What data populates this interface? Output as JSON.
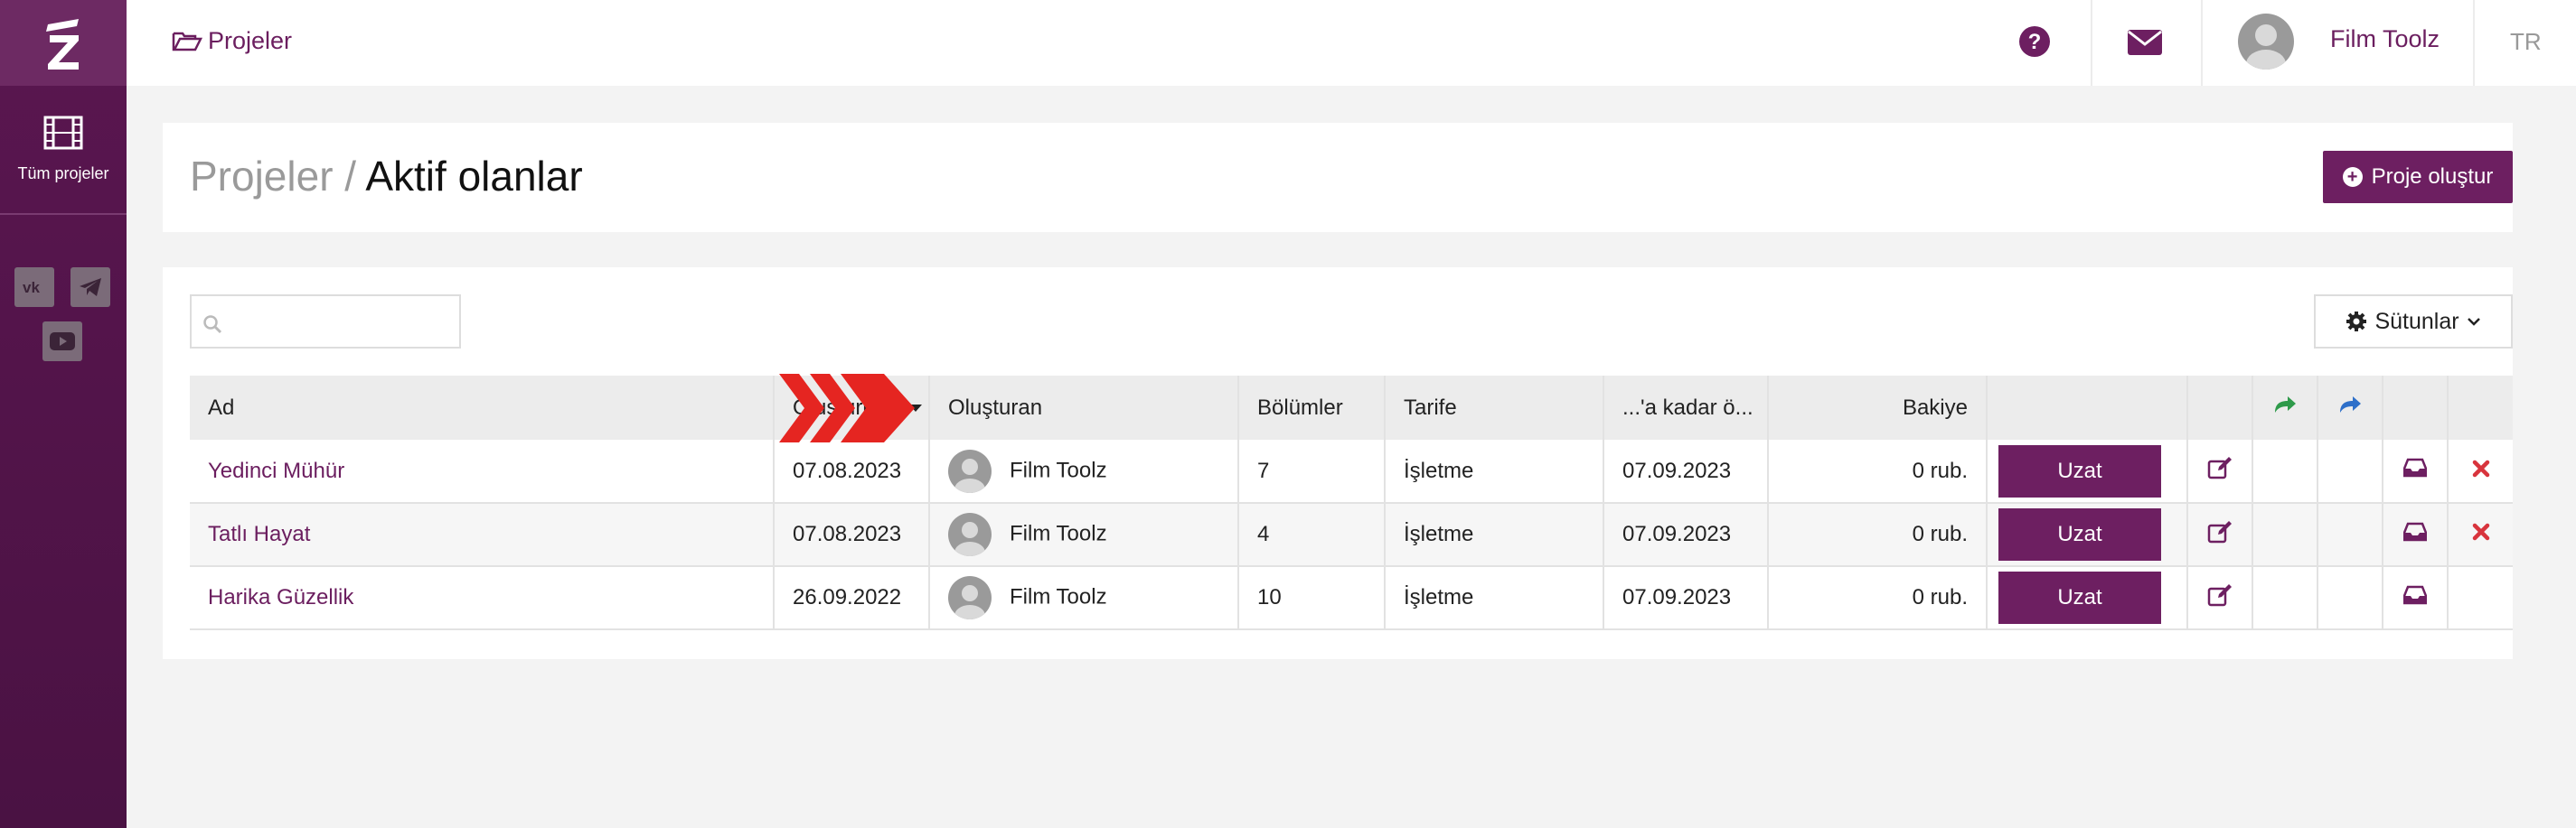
{
  "sidebar": {
    "logo": "film-toolz-logo",
    "nav_all_label": "Tüm projeler",
    "social": [
      "vk-icon",
      "telegram-icon",
      "youtube-icon"
    ]
  },
  "topbar": {
    "breadcrumb": "Projeler",
    "user_name": "Film Toolz",
    "language": "TR"
  },
  "header": {
    "title_muted": "Projeler /",
    "title_current": "Aktif olanlar",
    "create_button": "Proje oluştur"
  },
  "toolbar": {
    "search_placeholder": "",
    "columns_button": "Sütunlar"
  },
  "table": {
    "headers": {
      "name": "Ad",
      "created": "Oluşturuldu",
      "creator": "Oluşturan",
      "episodes": "Bölümler",
      "tariff": "Tarife",
      "until": "...'a kadar ö...",
      "balance": "Bakiye"
    },
    "rows": [
      {
        "name": "Yedinci Mühür",
        "created": "07.08.2023",
        "creator": "Film Toolz",
        "episodes": "7",
        "tariff": "İşletme",
        "until": "07.09.2023",
        "balance": "0 rub.",
        "action": "Uzat"
      },
      {
        "name": "Tatlı Hayat",
        "created": "07.08.2023",
        "creator": "Film Toolz",
        "episodes": "4",
        "tariff": "İşletme",
        "until": "07.09.2023",
        "balance": "0 rub.",
        "action": "Uzat"
      },
      {
        "name": "Harika Güzellik",
        "created": "26.09.2022",
        "creator": "Film Toolz",
        "episodes": "10",
        "tariff": "İşletme",
        "until": "07.09.2023",
        "balance": "0 rub.",
        "action": "Uzat"
      }
    ]
  },
  "colors": {
    "brand": "#6d1f61",
    "sidebar": "#4a1243",
    "share_green": "#2e9a4a",
    "share_blue": "#2d6fc9",
    "delete_red": "#d8343d",
    "arrow_red": "#e52521"
  }
}
